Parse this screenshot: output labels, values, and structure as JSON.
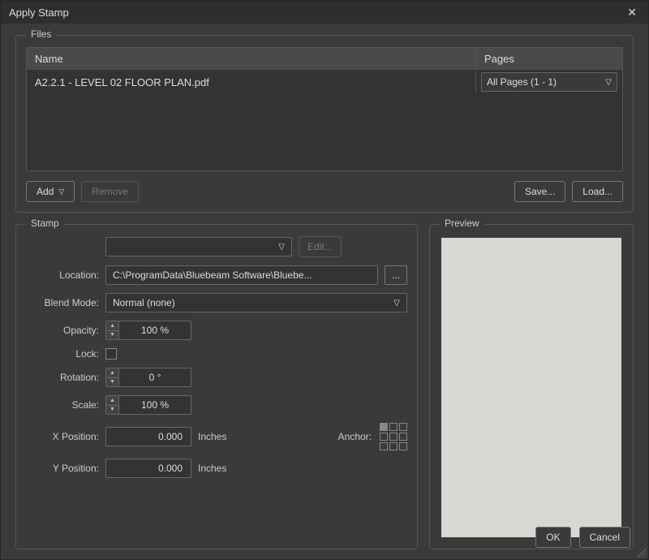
{
  "title": "Apply Stamp",
  "files": {
    "legend": "Files",
    "cols": {
      "name": "Name",
      "pages": "Pages"
    },
    "rows": [
      {
        "name": "A2.2.1 - LEVEL 02 FLOOR PLAN.pdf",
        "pages": "All Pages (1 - 1)"
      }
    ],
    "buttons": {
      "add": "Add",
      "remove": "Remove",
      "save": "Save...",
      "load": "Load..."
    }
  },
  "stamp": {
    "legend": "Stamp",
    "stamp_select": "",
    "edit": "Edit...",
    "location_label": "Location:",
    "location_value": "C:\\ProgramData\\Bluebeam Software\\Bluebe...",
    "browse": "...",
    "blend_label": "Blend Mode:",
    "blend_value": "Normal (none)",
    "opacity_label": "Opacity:",
    "opacity_value": "100 %",
    "lock_label": "Lock:",
    "lock_checked": false,
    "rotation_label": "Rotation:",
    "rotation_value": "0 °",
    "scale_label": "Scale:",
    "scale_value": "100 %",
    "xpos_label": "X Position:",
    "xpos_value": "0.000",
    "ypos_label": "Y Position:",
    "ypos_value": "0.000",
    "unit": "Inches",
    "anchor_label": "Anchor:",
    "anchor_selected": 0
  },
  "preview": {
    "legend": "Preview"
  },
  "footer": {
    "ok": "OK",
    "cancel": "Cancel"
  }
}
